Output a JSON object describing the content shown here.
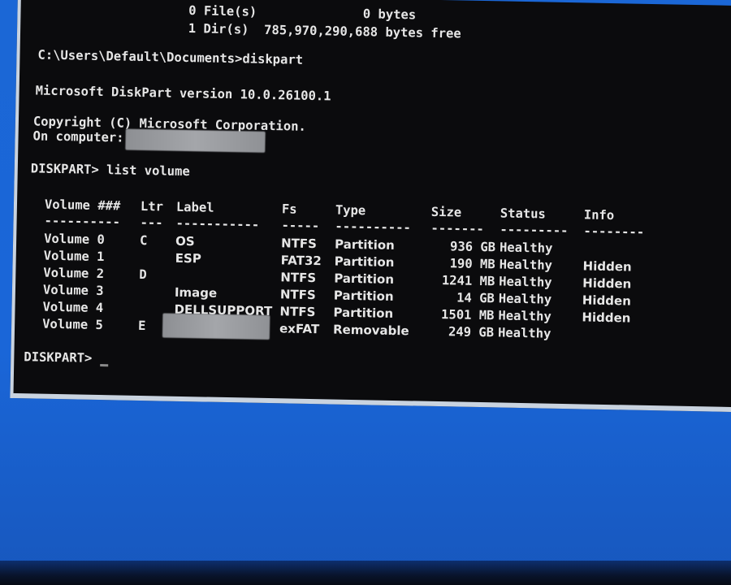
{
  "console": {
    "files_line": "        0 File(s)              0 bytes",
    "dirs_line": "        1 Dir(s)  785,970,290,688 bytes free",
    "prompt_cd": "C:\\Users\\Default\\Documents>diskpart",
    "version": "Microsoft DiskPart version 10.0.26100.1",
    "copyright": "Copyright (C) Microsoft Corporation.",
    "on_computer": "On computer:",
    "command": "DISKPART> list volume",
    "prompt_end": "DISKPART>"
  },
  "table": {
    "headers": {
      "volume": "Volume ###",
      "ltr": "Ltr",
      "label": "Label",
      "fs": "Fs",
      "type": "Type",
      "size": "Size",
      "status": "Status",
      "info": "Info"
    },
    "dashes": {
      "volume": "----------",
      "ltr": "---",
      "label": "-----------",
      "fs": "-----",
      "type": "----------",
      "size": "-------",
      "status": "---------",
      "info": "--------"
    },
    "rows": [
      {
        "volume": "Volume 0",
        "ltr": "C",
        "label": "OS",
        "fs": "NTFS",
        "type": "Partition",
        "size": "936 GB",
        "status": "Healthy",
        "info": ""
      },
      {
        "volume": "Volume 1",
        "ltr": "",
        "label": "ESP",
        "fs": "FAT32",
        "type": "Partition",
        "size": "190 MB",
        "status": "Healthy",
        "info": "Hidden"
      },
      {
        "volume": "Volume 2",
        "ltr": "D",
        "label": "",
        "fs": "NTFS",
        "type": "Partition",
        "size": "1241 MB",
        "status": "Healthy",
        "info": "Hidden"
      },
      {
        "volume": "Volume 3",
        "ltr": "",
        "label": "Image",
        "fs": "NTFS",
        "type": "Partition",
        "size": "14 GB",
        "status": "Healthy",
        "info": "Hidden"
      },
      {
        "volume": "Volume 4",
        "ltr": "",
        "label": "DELLSUPPORT",
        "fs": "NTFS",
        "type": "Partition",
        "size": "1501 MB",
        "status": "Healthy",
        "info": "Hidden"
      },
      {
        "volume": "Volume 5",
        "ltr": "E",
        "label": "",
        "fs": "exFAT",
        "type": "Removable",
        "size": "249 GB",
        "status": "Healthy",
        "info": ""
      }
    ]
  },
  "colors": {
    "console_bg": "#0b0b0d",
    "console_text": "#e6e6e6",
    "desktop_blue": "#1a66d8",
    "border": "#c9d3df"
  }
}
